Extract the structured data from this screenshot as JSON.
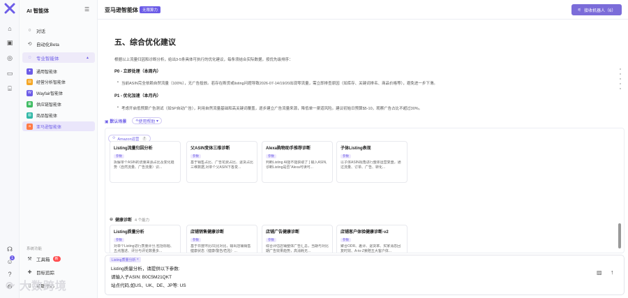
{
  "sidebar": {
    "header": "AI 智能体",
    "items": [
      {
        "label": "对话",
        "icon": "chat-icon"
      },
      {
        "label": "自动化Beta",
        "icon": "automation-icon"
      },
      {
        "label": "专业智能体",
        "icon": "bulb-icon"
      }
    ],
    "agents": [
      {
        "label": "通用智能体",
        "color": "#6c5ce7"
      },
      {
        "label": "经营分析智能体",
        "color": "#f5a623"
      },
      {
        "label": "Wayfair智能体",
        "color": "#6c5ce7"
      },
      {
        "label": "供应链智能体",
        "color": "#3dbb61"
      },
      {
        "label": "商品智能体",
        "color": "#2fb8a6"
      },
      {
        "label": "亚马逊智能体",
        "color": "#ff7a45"
      }
    ],
    "section_label": "系统功能",
    "tools": [
      {
        "label": "工具箱",
        "badge": "新"
      },
      {
        "label": "目标追踪",
        "badge": ""
      },
      {
        "label": "帮助中心",
        "badge": ""
      }
    ]
  },
  "watermark": "大数跨境",
  "topbar": {
    "title": "亚马逊智能体",
    "chip": "无限算力",
    "robot_button": "接收机器人（6）"
  },
  "article": {
    "heading": "五、综合优化建议",
    "intro": "根据以上流量归因和诊断分析，给出3-5条具体可执行的优化建议，每条须结合实际数据，按优先级排序：",
    "p0_title": "P0 - 立即处理（本周内）",
    "p0_item": "当前ASIN完全依赖自然流量（100%），无广告投放。若存在断货或listing问题导致2026-07-14/19/20出现零流量，需立即排查原因（如库存、关键词排名、商品价格等），避免进一步下滑。",
    "p1_title": "P1 - 优化加速（本月内）",
    "p1_item": "考虑开启低预算广告测试（如SP自动广告），利用自然流量基础和高关键词覆盖，逐步建立广告流量来源，降低单一渠道风险。建议初始日预算$5-10，观察广告占比不超过30%。"
  },
  "tabs": {
    "default_scene": "默认场景",
    "usage_help": "使用帮助"
  },
  "panel": {
    "group1_tag": "Amazon运营",
    "group1_count": "7",
    "cards_row1": [
      {
        "title": "Listing流量归因分析",
        "badge": "参数",
        "desc": "拆解单个ASIN的流量来源占比及变化趋势（自然流量、广告流量）识..."
      },
      {
        "title": "父ASIN变体三维诊断",
        "badge": "参数",
        "desc": "基于销售占比、广告花费占比、退货占比三维数据,对单个父ASIN下各变..."
      },
      {
        "title": "Alexa购物助手推荐诊断",
        "badge": "参数",
        "desc": "判断Listing AI能不能获取了 ] 输入ASIN,诊断Listing是否\"Alexa可读可..."
      },
      {
        "title": "子体Listing表现",
        "badge": "参数",
        "desc": "以子体ASIN视角进行整体运营复盘，通过流量、订单、广告、转化..."
      }
    ],
    "group2_title": "健康诊断",
    "group2_sub": "4 个能力",
    "cards_row2": [
      {
        "title": "Listing质量分析",
        "badge": "参数",
        "desc": "对单个Listing进行质量评分,包括标题、五点描述、评分与评论数量多..."
      },
      {
        "title": "店铺销售健康诊断",
        "badge": "参数",
        "desc": "基于日度环比/同比对比，输出店铺销售健康状态（健康/警告/危险）..."
      },
      {
        "title": "店铺广告健康诊断",
        "badge": "参数",
        "desc": "综合评估店铺整体广告汇总，当期与对比期广告效果趋势，高消耗无..."
      },
      {
        "title": "店铺客户体验健康诊断-v2",
        "badge": "参数",
        "desc": "聚合ODR、差评、退货率、买家消息回复时效、A-to-Z索赔五大客户体..."
      }
    ]
  },
  "composer": {
    "ref_chip": "Listing质量分析",
    "line1": "Listing质量分析，请提供以下参数:",
    "line2": "请输入子ASIN: B0C5M21QKT",
    "line3": "站点代码,如US、UK、DE、JP等: US"
  }
}
